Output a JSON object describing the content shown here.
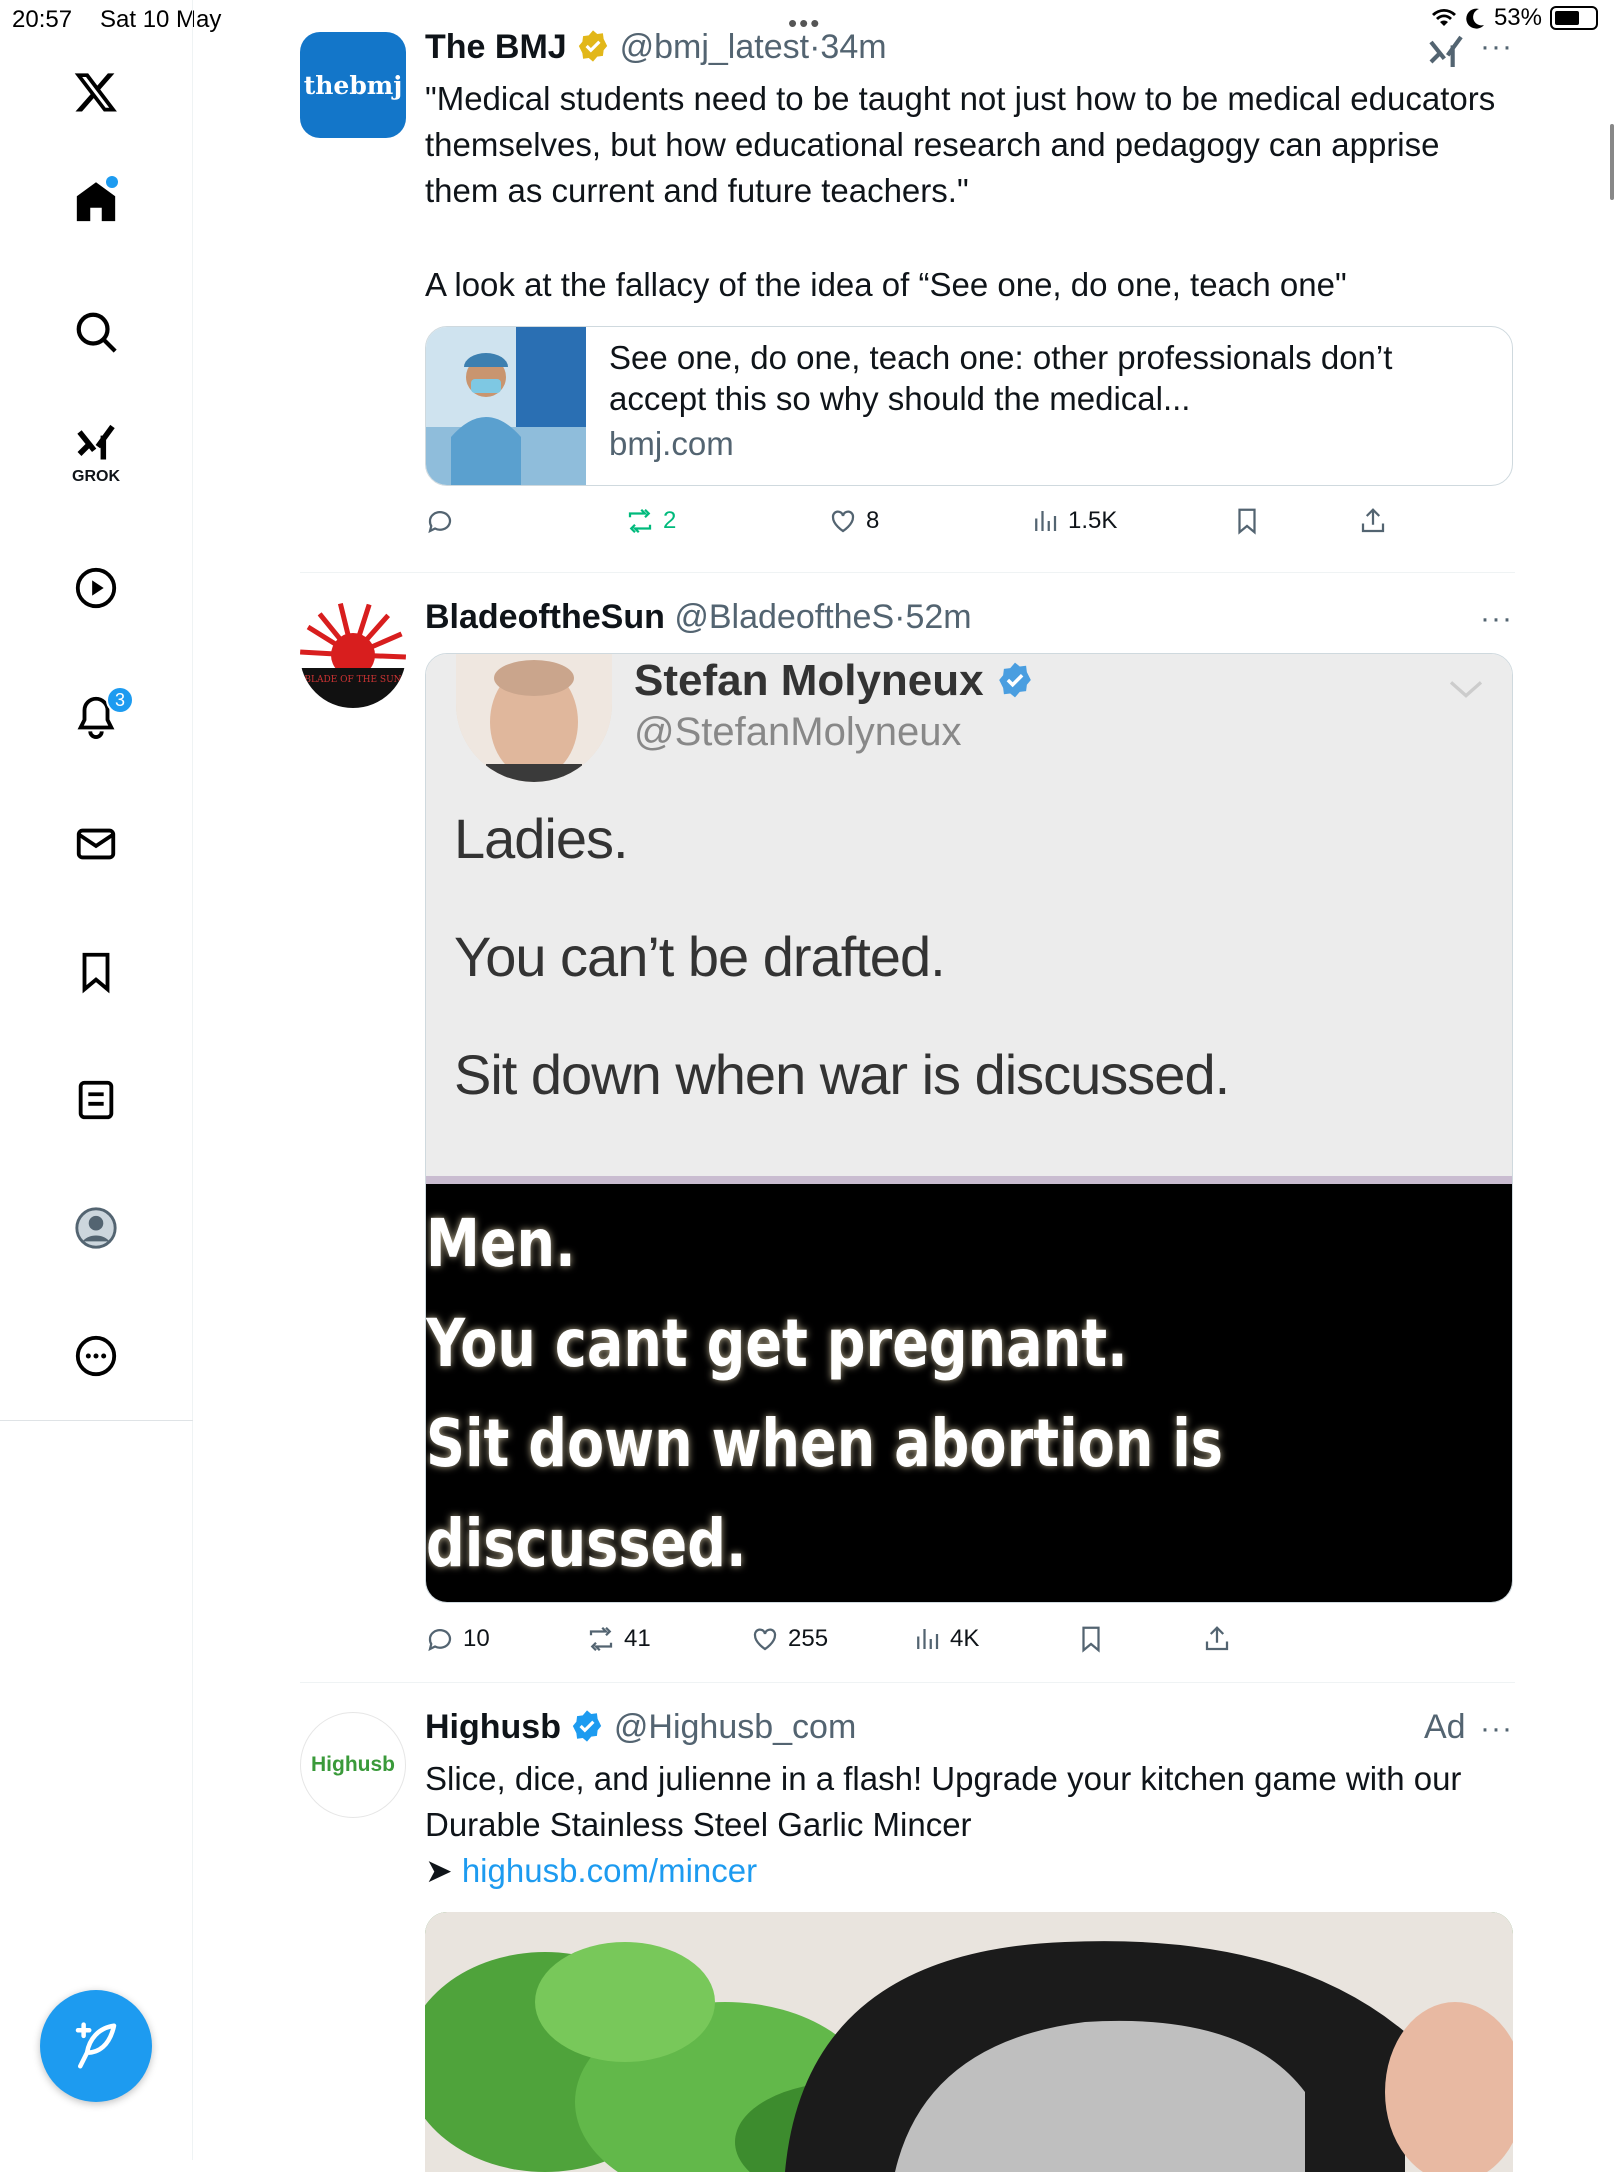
{
  "status": {
    "time": "20:57",
    "date": "Sat 10 May",
    "battery": "53%"
  },
  "nav": {
    "grok_label": "GROK",
    "notifications_count": "3"
  },
  "posts": [
    {
      "name": "The BMJ",
      "handle": "@bmj_latest",
      "time": "34m",
      "avatar_text": "thebmj",
      "text1": "\"Medical students need to be taught not just how to be medical educators themselves, but how educational research and pedagogy can apprise them as current and future teachers.\"",
      "text2": "A look at the fallacy of the idea of “See one, do one, teach one\"",
      "card_title": "See one, do one, teach one: other professionals don’t accept this so why should the medical...",
      "card_domain": "bmj.com",
      "stats": {
        "replies": "",
        "reposts": "2",
        "likes": "8",
        "views": "1.5K"
      }
    },
    {
      "name": "BladeoftheSun",
      "handle": "@BladeoftheS",
      "time": "52m",
      "avatar_text": "BLADE OF THE SUN",
      "media": {
        "name": "Stefan Molyneux",
        "handle": "@StefanMolyneux",
        "lines": [
          "Ladies.",
          "You can’t be drafted.",
          "Sit down when war is discussed."
        ],
        "bottom_lines": [
          "Men.",
          "You cant get pregnant.",
          "Sit down when abortion is",
          "discussed."
        ]
      },
      "stats": {
        "replies": "10",
        "reposts": "41",
        "likes": "255",
        "views": "4K"
      }
    },
    {
      "name": "Highusb",
      "handle": "@Highusb_com",
      "ad_label": "Ad",
      "avatar_text": "Highusb",
      "text1": "Slice, dice, and julienne in a flash! Upgrade your kitchen game with our Durable Stainless Steel Garlic Mincer",
      "arrow": "➤",
      "link": "highusb.com/mincer"
    }
  ],
  "colors": {
    "accent": "#1d9bf0",
    "repost": "#00ba7c",
    "muted": "#536471"
  }
}
